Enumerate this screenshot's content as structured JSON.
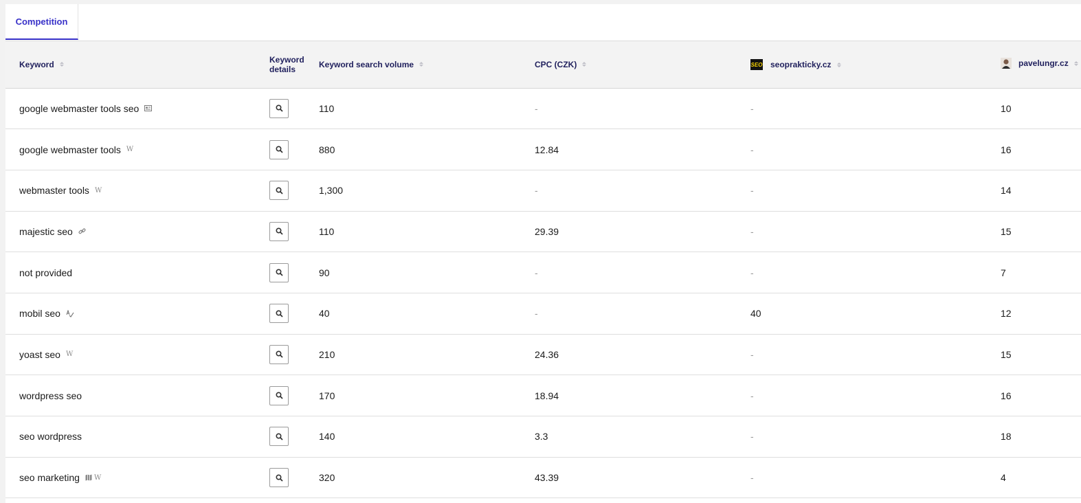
{
  "tabs": [
    {
      "label": "Competition",
      "active": true
    }
  ],
  "columns": {
    "keyword": "Keyword",
    "details": "Keyword details",
    "volume": "Keyword search volume",
    "cpc": "CPC (CZK)",
    "site1": "seoprakticky.cz",
    "site1_logo": "SEO",
    "site2": "pavelungr.cz"
  },
  "rows": [
    {
      "keyword": "google webmaster tools seo",
      "features": [
        "feature-snippet-icon"
      ],
      "volume": "110",
      "cpc": "-",
      "site1": "-",
      "site2": "10"
    },
    {
      "keyword": "google webmaster tools",
      "features": [
        "wikipedia-icon"
      ],
      "volume": "880",
      "cpc": "12.84",
      "site1": "-",
      "site2": "16"
    },
    {
      "keyword": "webmaster tools",
      "features": [
        "wikipedia-icon"
      ],
      "volume": "1,300",
      "cpc": "-",
      "site1": "-",
      "site2": "14"
    },
    {
      "keyword": "majestic seo",
      "features": [
        "link-icon"
      ],
      "volume": "110",
      "cpc": "29.39",
      "site1": "-",
      "site2": "15"
    },
    {
      "keyword": "not provided",
      "features": [],
      "volume": "90",
      "cpc": "-",
      "site1": "-",
      "site2": "7"
    },
    {
      "keyword": "mobil seo",
      "features": [
        "spellcheck-icon"
      ],
      "volume": "40",
      "cpc": "-",
      "site1": "40",
      "site2": "12"
    },
    {
      "keyword": "yoast seo",
      "features": [
        "wikipedia-icon"
      ],
      "volume": "210",
      "cpc": "24.36",
      "site1": "-",
      "site2": "15"
    },
    {
      "keyword": "wordpress seo",
      "features": [],
      "volume": "170",
      "cpc": "18.94",
      "site1": "-",
      "site2": "16"
    },
    {
      "keyword": "seo wordpress",
      "features": [],
      "volume": "140",
      "cpc": "3.3",
      "site1": "-",
      "site2": "18"
    },
    {
      "keyword": "seo marketing",
      "features": [
        "map-icon",
        "wikipedia-icon"
      ],
      "volume": "320",
      "cpc": "43.39",
      "site1": "-",
      "site2": "4"
    }
  ],
  "colors": {
    "accent": "#3730c8",
    "header_bg": "#f3f3f3",
    "header_text": "#1f1f5c"
  }
}
